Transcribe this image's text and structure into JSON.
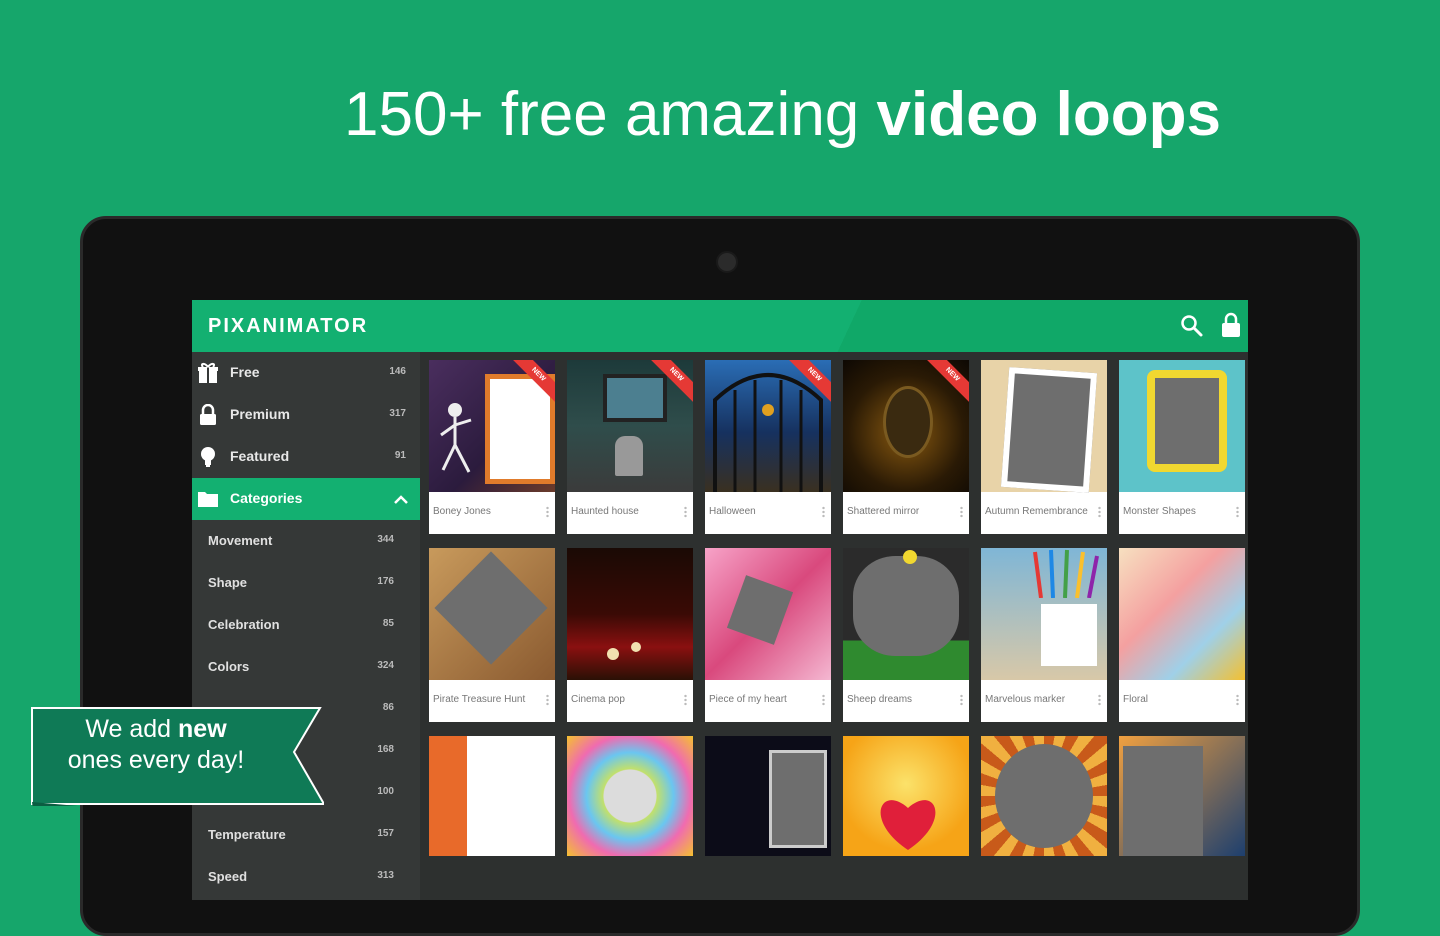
{
  "headline": {
    "prefix": "150+ free amazing ",
    "bold": "video loops"
  },
  "app": {
    "title": "PIXANIMATOR"
  },
  "sidebar": {
    "items": [
      {
        "label": "Free",
        "count": "146"
      },
      {
        "label": "Premium",
        "count": "317"
      },
      {
        "label": "Featured",
        "count": "91"
      },
      {
        "label": "Categories"
      }
    ],
    "subitems": [
      {
        "label": "Movement",
        "count": "344"
      },
      {
        "label": "Shape",
        "count": "176"
      },
      {
        "label": "Celebration",
        "count": "85"
      },
      {
        "label": "Colors",
        "count": "324"
      },
      {
        "label": "",
        "count": "86"
      },
      {
        "label": "",
        "count": "168"
      },
      {
        "label": "",
        "count": "100"
      },
      {
        "label": "Temperature",
        "count": "157"
      },
      {
        "label": "Speed",
        "count": "313"
      }
    ]
  },
  "cards": [
    {
      "caption": "Boney Jones",
      "badge": "NEW"
    },
    {
      "caption": "Haunted house",
      "badge": "NEW"
    },
    {
      "caption": "Halloween",
      "badge": "NEW"
    },
    {
      "caption": "Shattered mirror",
      "badge": "NEW"
    },
    {
      "caption": "Autumn Remembrance"
    },
    {
      "caption": "Monster Shapes"
    },
    {
      "caption": "Pirate Treasure Hunt"
    },
    {
      "caption": "Cinema pop"
    },
    {
      "caption": "Piece of my heart"
    },
    {
      "caption": "Sheep dreams"
    },
    {
      "caption": "Marvelous marker"
    },
    {
      "caption": "Floral"
    }
  ],
  "banner": {
    "line1_prefix": "We add ",
    "line1_bold": "new",
    "line2": "ones every day!"
  },
  "colors": {
    "background": "#16a66b",
    "appbar": "#13b071",
    "sidebar": "#353837",
    "badge": "#e53935"
  }
}
